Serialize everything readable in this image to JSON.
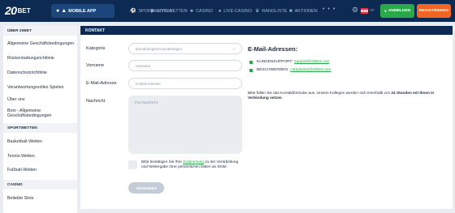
{
  "header": {
    "logo_number": "20",
    "logo_text": "BET",
    "mobile_app_label": "MOBILE APP",
    "nav": [
      "SPORTWETTEN",
      "LIVE-WETTEN",
      "CASINO",
      "LIVE-CASINO",
      "RANGLISTE",
      "AKTIONEN"
    ],
    "more": "• • •",
    "lang": "AT",
    "login_label": "ANMELDEN",
    "register_label": "REGISTRIEREN"
  },
  "sidebar": {
    "sections": [
      {
        "title": "ÜBER 20BET",
        "items": [
          "Allgemeine Geschäftsbedingungen",
          "Rückerstattungsrichtlinie",
          "Datenschutzrichtlinie",
          "Verantwortungsvolles Spielen",
          "Über uns",
          "Boni - Allgemeine Geschäftsbedingungen"
        ]
      },
      {
        "title": "SPORTWETTEN",
        "items": [
          "Basketball-Wetten",
          "Tennis-Wetten",
          "Fußball-Wetten"
        ]
      },
      {
        "title": "CASINO",
        "items": [
          "Beliebte Slots"
        ]
      }
    ]
  },
  "contact": {
    "title": "KONTAKT",
    "category_label": "Kategorie",
    "category_value": "Einzahlungen/Auszahlungen",
    "first_name_label": "Vorname",
    "first_name_placeholder": "Vorname",
    "email_label": "E-Mail-Adresse",
    "email_placeholder": "E-Mail-Adresse",
    "message_label": "Nachricht",
    "message_placeholder": "Ihre Nachricht",
    "consent_before": "Bitte bestätigen Sie Ihre",
    "consent_link": "Zustimmung",
    "consent_after": "zu der Verarbeitung und Weitergabe Ihrer persönlichen Daten an Dritte.",
    "submit_label": "ABSENDEN"
  },
  "emails": {
    "title": "E-Mail-Adressen:",
    "support_label": "KUNDENSUPPORT:",
    "support_email": "support@20bet.com",
    "complaints_label": "BESCHWERDEN:",
    "complaints_email": "complaints@20bet.com",
    "note_before": "Bitte füllen Sie das Kontaktformular aus. Unsere Kollegen werden sich innerhalb von",
    "note_bold": "24 Stunden mit Ihnen in Verbindung setzen",
    "note_after": "."
  },
  "colors": {
    "header_bg": "#0d2a52",
    "accent_green": "#2ba84a",
    "accent_orange": "#f26522",
    "page_bg": "#e9edf2"
  }
}
